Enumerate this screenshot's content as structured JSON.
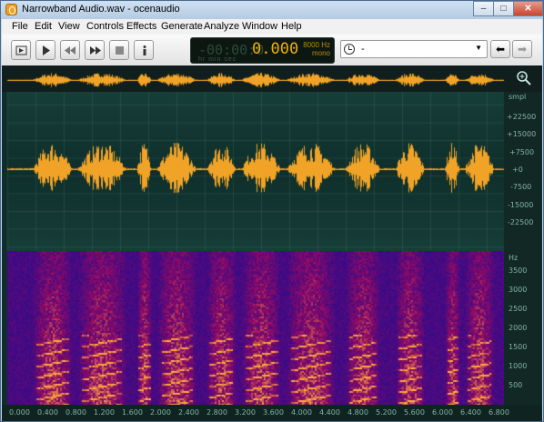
{
  "window": {
    "title": "Narrowband Audio.wav - ocenaudio",
    "min_label": "–",
    "max_label": "□",
    "close_label": "✕"
  },
  "menu": [
    "File",
    "Edit",
    "View",
    "Controls",
    "Effects",
    "Generate",
    "Analyze",
    "Window",
    "Help"
  ],
  "toolbar": {
    "buttons": [
      "selection-tool",
      "play",
      "rewind",
      "fast-forward",
      "stop",
      "info"
    ],
    "time_dim": "-00:00:0",
    "time_value": "0.000",
    "time_units": "hr   min  sec",
    "sample_rate": "8000 Hz",
    "channels": "mono",
    "history_value": "-"
  },
  "waveform": {
    "unit": "smpl",
    "ticks": [
      "+22500",
      "+15000",
      "+7500",
      "+0",
      "-7500",
      "-15000",
      "-22500"
    ],
    "colors": {
      "wave": "#f0a326",
      "background": "#123530"
    }
  },
  "spectrogram": {
    "unit": "Hz",
    "ticks": [
      "3500",
      "3000",
      "2500",
      "2000",
      "1500",
      "1000",
      "500"
    ]
  },
  "timeline": {
    "ticks": [
      "0.000",
      "0.400",
      "0.800",
      "1.200",
      "1.600",
      "2.000",
      "2.400",
      "2.800",
      "3.200",
      "3.600",
      "4.000",
      "4.400",
      "4.800",
      "5.200",
      "5.600",
      "6.000",
      "6.400",
      "6.800"
    ]
  }
}
